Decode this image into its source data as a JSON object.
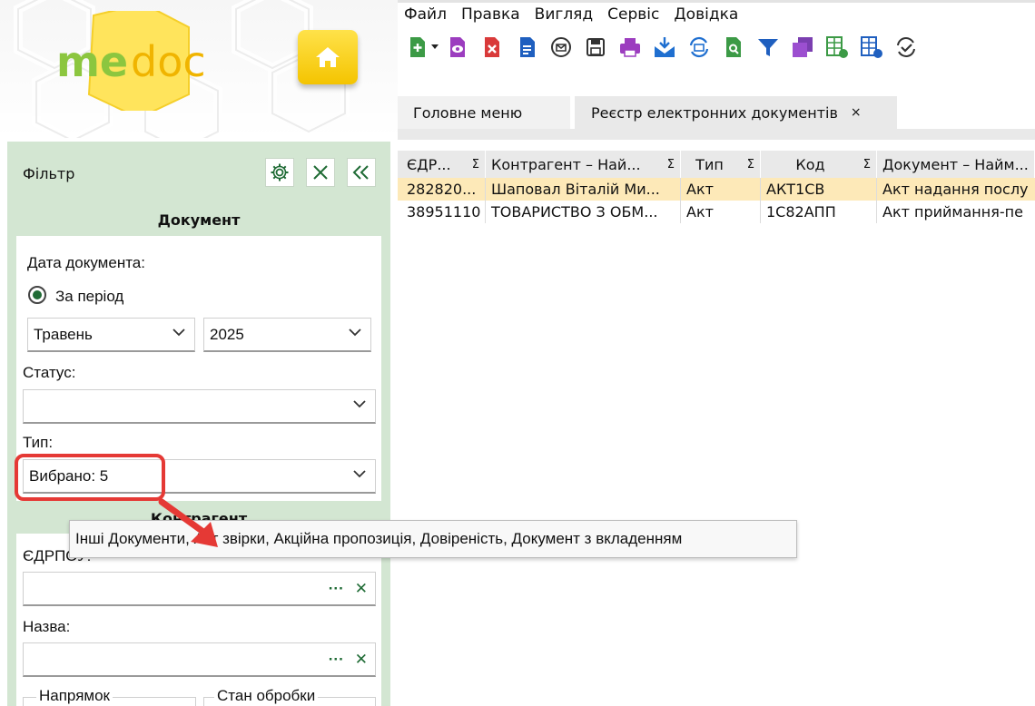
{
  "menu": [
    "Файл",
    "Правка",
    "Вигляд",
    "Сервіс",
    "Довідка"
  ],
  "logo": {
    "part1": "me",
    "part2": "doc",
    "brand_green": "#8cc63f",
    "brand_yellow": "#f4c400"
  },
  "toolbar_icons": [
    "add-document-icon",
    "view-document-icon",
    "delete-document-icon",
    "copy-document-icon",
    "receive-mail-icon",
    "save-icon",
    "print-icon",
    "send-icon",
    "exchange-icon",
    "search-document-icon",
    "filter-icon",
    "duplicate-icon",
    "table-settings-icon",
    "table-c-icon",
    "check-sync-icon"
  ],
  "tabs": {
    "main": "Головне меню",
    "registry": "Реєстр електронних документів",
    "close": "×"
  },
  "filter": {
    "title": "Фільтр",
    "document_section": "Документ",
    "date_label": "Дата документа:",
    "period_label": "За період",
    "month": "Травень",
    "year": "2025",
    "status_label": "Статус:",
    "status_value": "",
    "type_label": "Тип:",
    "type_value": "Вибрано: 5",
    "counterparty_section": "Контрагент",
    "edrpou_label": "ЄДРПОУ:",
    "name_label": "Назва:",
    "direction_label": "Напрямок",
    "processing_label": "Стан обробки",
    "ellipsis": "···",
    "clear": "✕"
  },
  "tooltip": "Інші Документи, Акт звірки, Акційна пропозиція, Довіреність, Документ з вкладенням",
  "table": {
    "columns": [
      "ЄДР...",
      "Контрагент – Най...",
      "Тип",
      "Код",
      "Документ – Найм..."
    ],
    "sigma": "Σ",
    "rows": [
      [
        "282820...",
        "Шаповал Віталій Ми...",
        "Акт",
        "АКТ1СВ",
        "Акт надання послу"
      ],
      [
        "38951110",
        "ТОВАРИСТВО З ОБМ...",
        "Акт",
        "1С82АПП",
        "Акт приймання-пе"
      ]
    ],
    "selected_row_color": "#fde9b8"
  },
  "colors": {
    "panel_bg": "#d3e6d2",
    "accent_green": "#1f6b35",
    "highlight_red": "#e53935"
  }
}
